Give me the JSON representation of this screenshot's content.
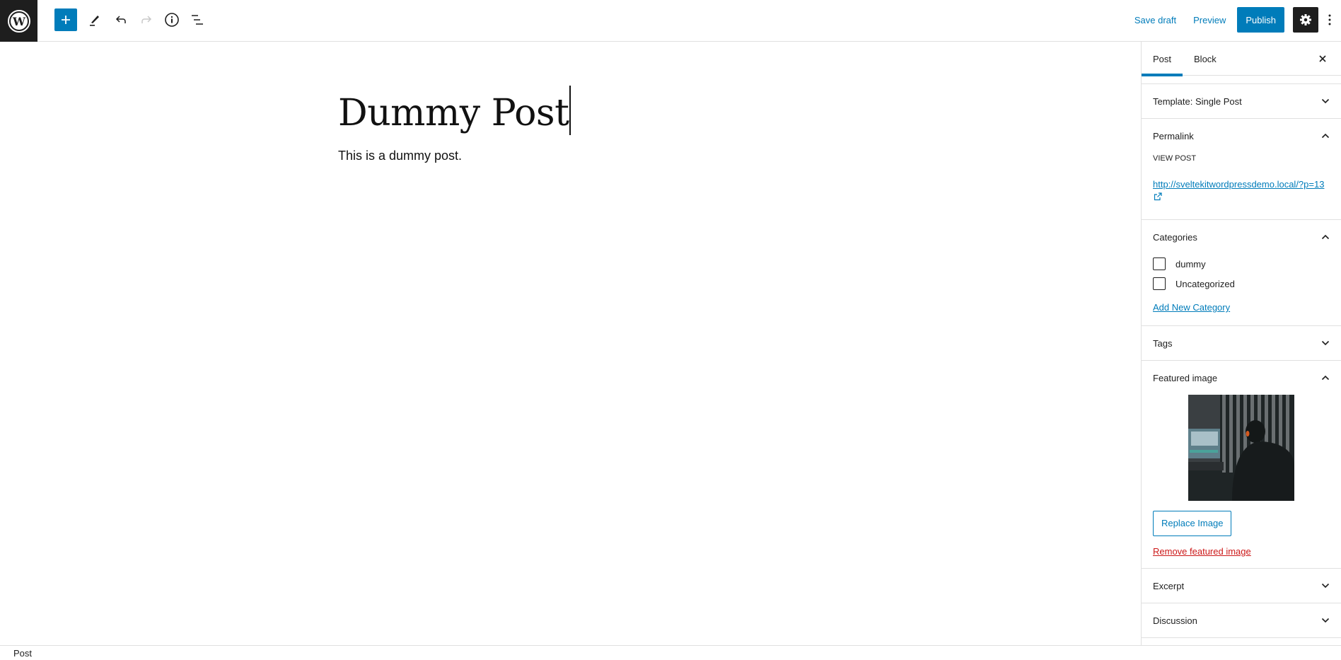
{
  "toolbar": {
    "logo": "wordpress-logo",
    "add_block_icon": "plus-icon",
    "tools_icon": "pencil-icon",
    "undo_icon": "undo-icon",
    "redo_icon": "redo-icon",
    "details_icon": "info-icon",
    "list_view_icon": "list-view-icon",
    "save_draft": "Save draft",
    "preview": "Preview",
    "publish": "Publish",
    "settings_icon": "gear-icon",
    "more_icon": "more-vertical-icon",
    "accent_color": "#007cba"
  },
  "editor": {
    "title": "Dummy Post",
    "body": "This is a dummy post."
  },
  "sidebar": {
    "tabs": [
      {
        "label": "Post",
        "active": true
      },
      {
        "label": "Block",
        "active": false
      }
    ],
    "panels": {
      "template": {
        "label": "Template: Single Post",
        "expanded": false
      },
      "permalink": {
        "label": "Permalink",
        "expanded": true,
        "view_post_label": "VIEW POST",
        "url": "http://sveltekitwordpressdemo.local/?p=13"
      },
      "categories": {
        "label": "Categories",
        "expanded": true,
        "items": [
          {
            "label": "dummy",
            "checked": false
          },
          {
            "label": "Uncategorized",
            "checked": false
          }
        ],
        "add_new": "Add New Category"
      },
      "tags": {
        "label": "Tags",
        "expanded": false
      },
      "featured_image": {
        "label": "Featured image",
        "expanded": true,
        "replace": "Replace Image",
        "remove": "Remove featured image",
        "remove_color": "#cc1818"
      },
      "excerpt": {
        "label": "Excerpt",
        "expanded": false
      },
      "discussion": {
        "label": "Discussion",
        "expanded": false
      }
    }
  },
  "footer": {
    "breadcrumb": "Post"
  }
}
